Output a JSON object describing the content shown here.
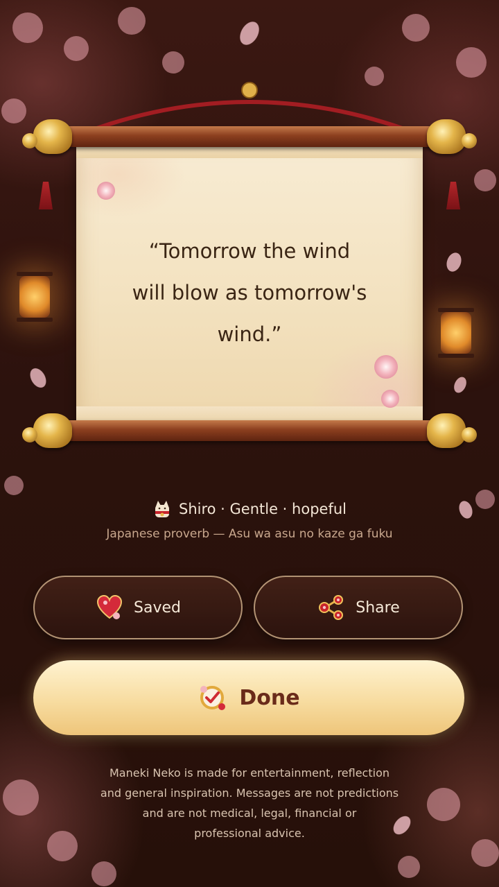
{
  "quote": {
    "text_line1": "“Tomorrow the wind",
    "text_line2": "will blow as tomorrow's",
    "text_line3": "wind.”"
  },
  "meta": {
    "character": "Shiro · Gentle · hopeful",
    "source": "Japanese proverb — Asu wa asu no kaze ga fuku"
  },
  "actions": {
    "saved_label": "Saved",
    "share_label": "Share",
    "done_label": "Done"
  },
  "disclaimer": {
    "line1": "Maneki Neko is made for entertainment, reflection",
    "line2": "and general inspiration. Messages are not predictions",
    "line3": "and are not medical, legal, financial or",
    "line4": "professional advice."
  },
  "icons": {
    "character": "cat-icon",
    "saved": "heart-icon",
    "share": "share-icon",
    "done": "checkmark-badge-icon"
  },
  "colors": {
    "background": "#2c120d",
    "scroll_paper": "#f3e2c0",
    "done_button": "#f7dca0",
    "done_text": "#6a2b1a",
    "heart": "#d42a3a"
  }
}
